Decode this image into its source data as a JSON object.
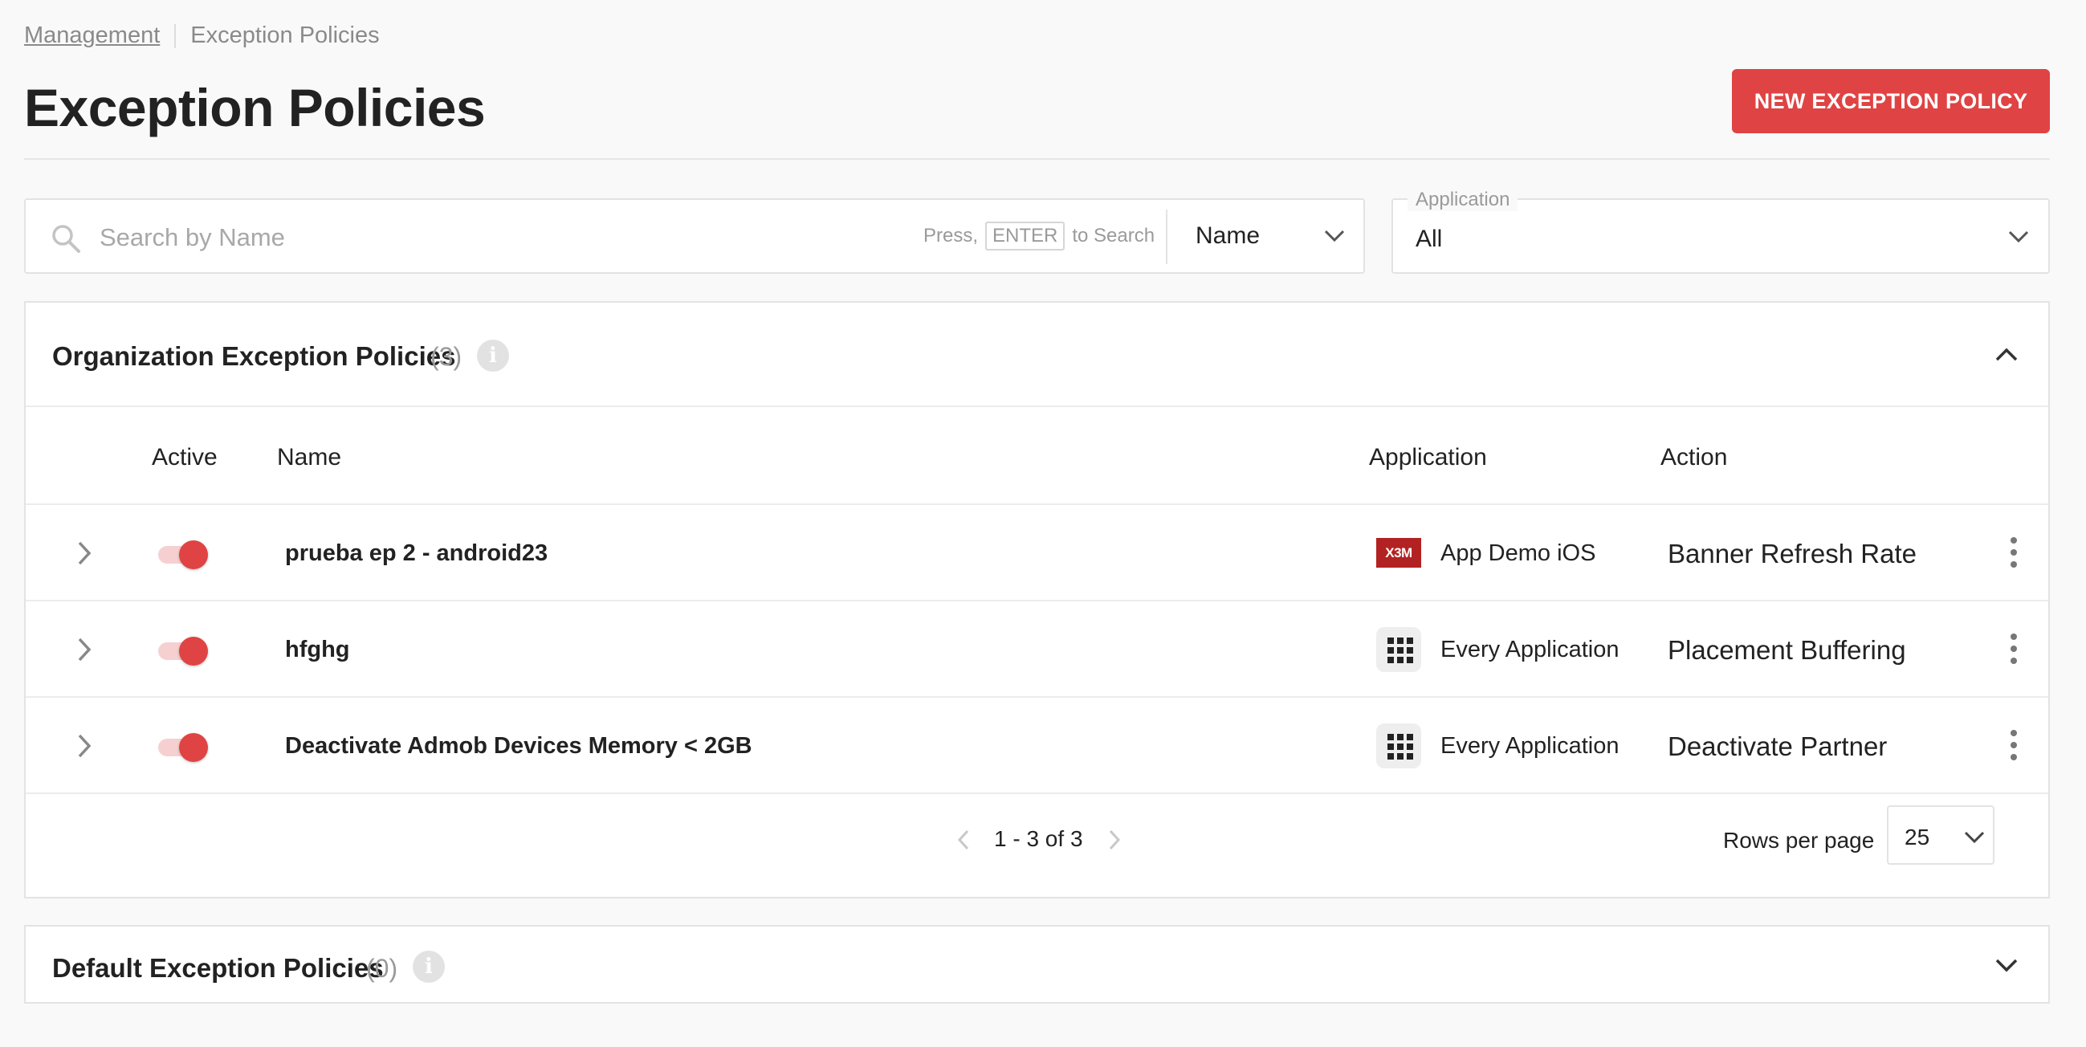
{
  "breadcrumb": {
    "parent": "Management",
    "current": "Exception Policies"
  },
  "page_title": "Exception Policies",
  "new_button_label": "NEW EXCEPTION POLICY",
  "search": {
    "placeholder": "Search by Name",
    "hint_before": "Press,",
    "hint_key": "ENTER",
    "hint_after": "to Search",
    "field_value": "Name"
  },
  "application_filter": {
    "label": "Application",
    "value": "All"
  },
  "org_panel": {
    "title": "Organization Exception Policies",
    "count": "(3)",
    "columns": {
      "active": "Active",
      "name": "Name",
      "application": "Application",
      "action": "Action"
    },
    "rows": [
      {
        "active": true,
        "name": "prueba ep 2 - android23",
        "app_icon": "app-logo",
        "app_logo_text": "X3M",
        "application": "App Demo iOS",
        "action": "Banner Refresh Rate"
      },
      {
        "active": true,
        "name": "hfghg",
        "app_icon": "grid-icon",
        "application": "Every Application",
        "action": "Placement Buffering"
      },
      {
        "active": true,
        "name": "Deactivate Admob Devices Memory < 2GB",
        "app_icon": "grid-icon",
        "application": "Every Application",
        "action": "Deactivate Partner"
      }
    ],
    "pagination": {
      "range": "1 - 3 of 3",
      "rows_per_page_label": "Rows per page",
      "rows_per_page": "25"
    }
  },
  "default_panel": {
    "title": "Default Exception Policies",
    "count": "(0)"
  },
  "colors": {
    "accent": "#e04343",
    "toggle_track": "#f6d0d0",
    "background": "#f9f9f9"
  }
}
